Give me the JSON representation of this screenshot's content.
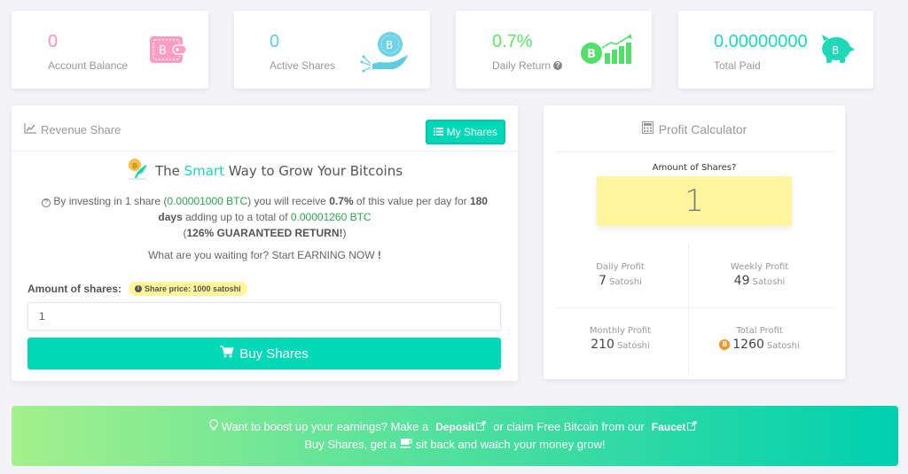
{
  "stats": [
    {
      "value": "0",
      "label": "Account Balance",
      "icon": "wallet-bitcoin-icon",
      "color": "#ff8fbc"
    },
    {
      "value": "0",
      "label": "Active Shares",
      "icon": "hand-coin-icon",
      "color": "#5dcde0"
    },
    {
      "value": "0.7%",
      "label": "Daily Return",
      "icon": "bitcoin-growth-chart-icon",
      "color": "#5ee46a"
    },
    {
      "value": "0.00000000",
      "label": "Total Paid",
      "icon": "piggy-bank-bitcoin-icon",
      "color": "#1ed8b8"
    }
  ],
  "revenue_share": {
    "title": "Revenue Share",
    "my_shares_label": "My Shares",
    "headline_pre": "The ",
    "headline_accent": "Smart",
    "headline_post": " Way to Grow Your Bitcoins",
    "desc": {
      "p1": "By investing in 1 share (",
      "share_btc": "0.00001000 BTC",
      "p2": ") you will receive ",
      "rate": "0.7%",
      "p3": " of this value per day for ",
      "days": "180 days",
      "p4": " adding up to a total of ",
      "total_btc": "0.00001260 BTC",
      "p5": "(",
      "guarantee": "126% GUARANTEED RETURN!",
      "p6": ")"
    },
    "waiting_text": "What are you waiting for? Start EARNING NOW",
    "waiting_bang": "!",
    "amount_label": "Amount of shares:",
    "price_badge": "Share price: 1000 satoshi",
    "amount_value": "1",
    "buy_label": "Buy Shares"
  },
  "calculator": {
    "title": "Profit Calculator",
    "question": "Amount of Shares?",
    "amount": "1",
    "unit": "Satoshi",
    "daily_label": "Daily Profit",
    "daily_value": "7",
    "weekly_label": "Weekly Profit",
    "weekly_value": "49",
    "monthly_label": "Monthly Profit",
    "monthly_value": "210",
    "total_label": "Total Profit",
    "total_value": "1260"
  },
  "banner": {
    "line1_pre": "Want to boost up your earnings? Make a",
    "deposit": "Deposit",
    "line1_mid": "or claim Free Bitcoin from our",
    "faucet": "Faucet",
    "line2_pre": "Buy Shares, get a",
    "line2_post": "sit back and watch your money grow!"
  }
}
